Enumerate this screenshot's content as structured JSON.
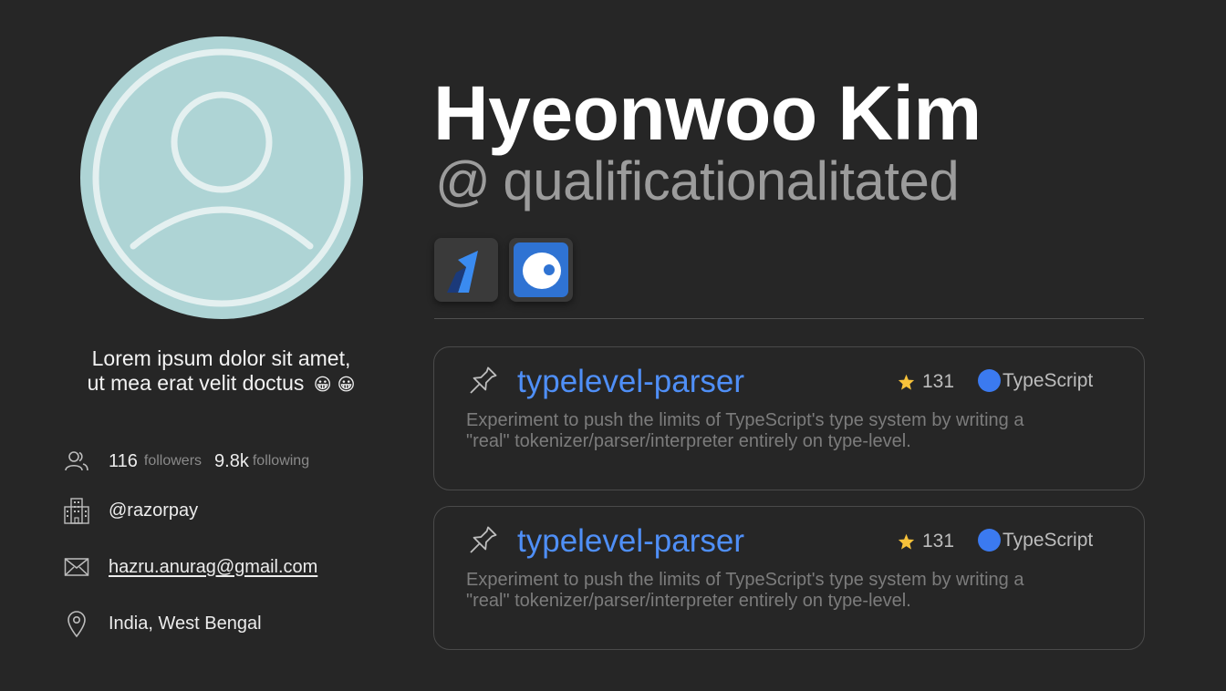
{
  "profile": {
    "name": "Hyeonwoo Kim",
    "handle_at": "@",
    "handle": "qualificationalitated",
    "bio_line1": "Lorem ipsum dolor sit amet,",
    "bio_line2": "ut mea erat velit doctus",
    "bio_emoji": "😀 😀"
  },
  "stats": {
    "followers_count": "116",
    "followers_label": "followers",
    "following_count": "9.8k",
    "following_label": "following"
  },
  "info": {
    "company": "@razorpay",
    "email": "hazru.anurag@gmail.com",
    "location": "India, West Bengal"
  },
  "organizations": [
    {
      "icon": "razorpay-logo"
    },
    {
      "icon": "blue-eye-logo"
    }
  ],
  "pinned_repos": [
    {
      "name": "typelevel-parser",
      "stars": "131",
      "language": "TypeScript",
      "language_color": "#3b7af0",
      "description_line1": "Experiment to push the limits of TypeScript's type system by writing a",
      "description_line2": "\"real\" tokenizer/parser/interpreter entirely on type-level."
    },
    {
      "name": "typelevel-parser",
      "stars": "131",
      "language": "TypeScript",
      "language_color": "#3b7af0",
      "description_line1": "Experiment to push the limits of TypeScript's type system by writing a",
      "description_line2": "\"real\" tokenizer/parser/interpreter entirely on type-level."
    }
  ],
  "colors": {
    "background": "#262626",
    "avatar_bg": "#aed4d5",
    "link_blue": "#4f8ff7",
    "star_yellow": "#f7c23a"
  }
}
